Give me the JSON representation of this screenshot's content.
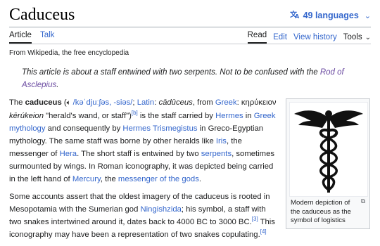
{
  "page": {
    "title": "Caduceus",
    "languages_label": "49 languages",
    "tabs_left": [
      "Article",
      "Talk"
    ],
    "tabs_right": [
      "Read",
      "Edit",
      "View history",
      "Tools"
    ],
    "tagline": "From Wikipedia, the free encyclopedia",
    "hatnote": {
      "text": "This article is about a staff entwined with two serpents. Not to be confused with the ",
      "link": "Rod of Asclepius",
      "end": "."
    }
  },
  "p1": {
    "t1": "The ",
    "bold": "caduceus",
    "t2": " (",
    "ipa": "/kəˈdjuːʃəs, -siəs/",
    "t3": "; ",
    "latin": "Latin",
    "t4": ": ",
    "latin_word": "cādūceus",
    "t5": ", from ",
    "greek": "Greek",
    "t6": ": κηρύκειον ",
    "greek_translit": "kērúkeion",
    "t7": " \"herald's wand, or staff\")",
    "ref_b": "[b]",
    "t8": " is the staff carried by ",
    "hermes": "Hermes",
    "t9": " in ",
    "greek_myth": "Greek mythology",
    "t10": " and consequently by ",
    "hermes_tris": "Hermes Trismegistus",
    "t11": " in Greco-Egyptian mythology. The same staff was borne by other heralds like ",
    "iris": "Iris",
    "t12": ", the messenger of ",
    "hera": "Hera",
    "t13": ". The short staff is entwined by two ",
    "serpents": "serpents",
    "t14": ", sometimes surmounted by wings. In Roman iconography, it was depicted being carried in the left hand of ",
    "mercury": "Mercury",
    "t15": ", the ",
    "messenger": "messenger of the gods",
    "t16": "."
  },
  "p2": {
    "t1": "Some accounts assert that the oldest imagery of the caduceus is rooted in Mesopotamia with the Sumerian god ",
    "ningishzida": "Ningishzida",
    "t2": "; his symbol, a staff with two snakes intertwined around it, dates back to 4000 BC to 3000 BC.",
    "ref3": "[3]",
    "t3": " This iconography may have been a representation of two snakes copulating.",
    "ref4": "[4]"
  },
  "infobox": {
    "caption": "Modern depiction of the caduceus as the symbol of logistics"
  },
  "icons": {
    "language": "translate-icon",
    "chevron": "chevron-down-icon",
    "audio": "speaker-icon",
    "enlarge": "enlarge-icon"
  },
  "colors": {
    "link": "#3366cc",
    "visited_link": "#6b4ba1",
    "text": "#202122"
  }
}
